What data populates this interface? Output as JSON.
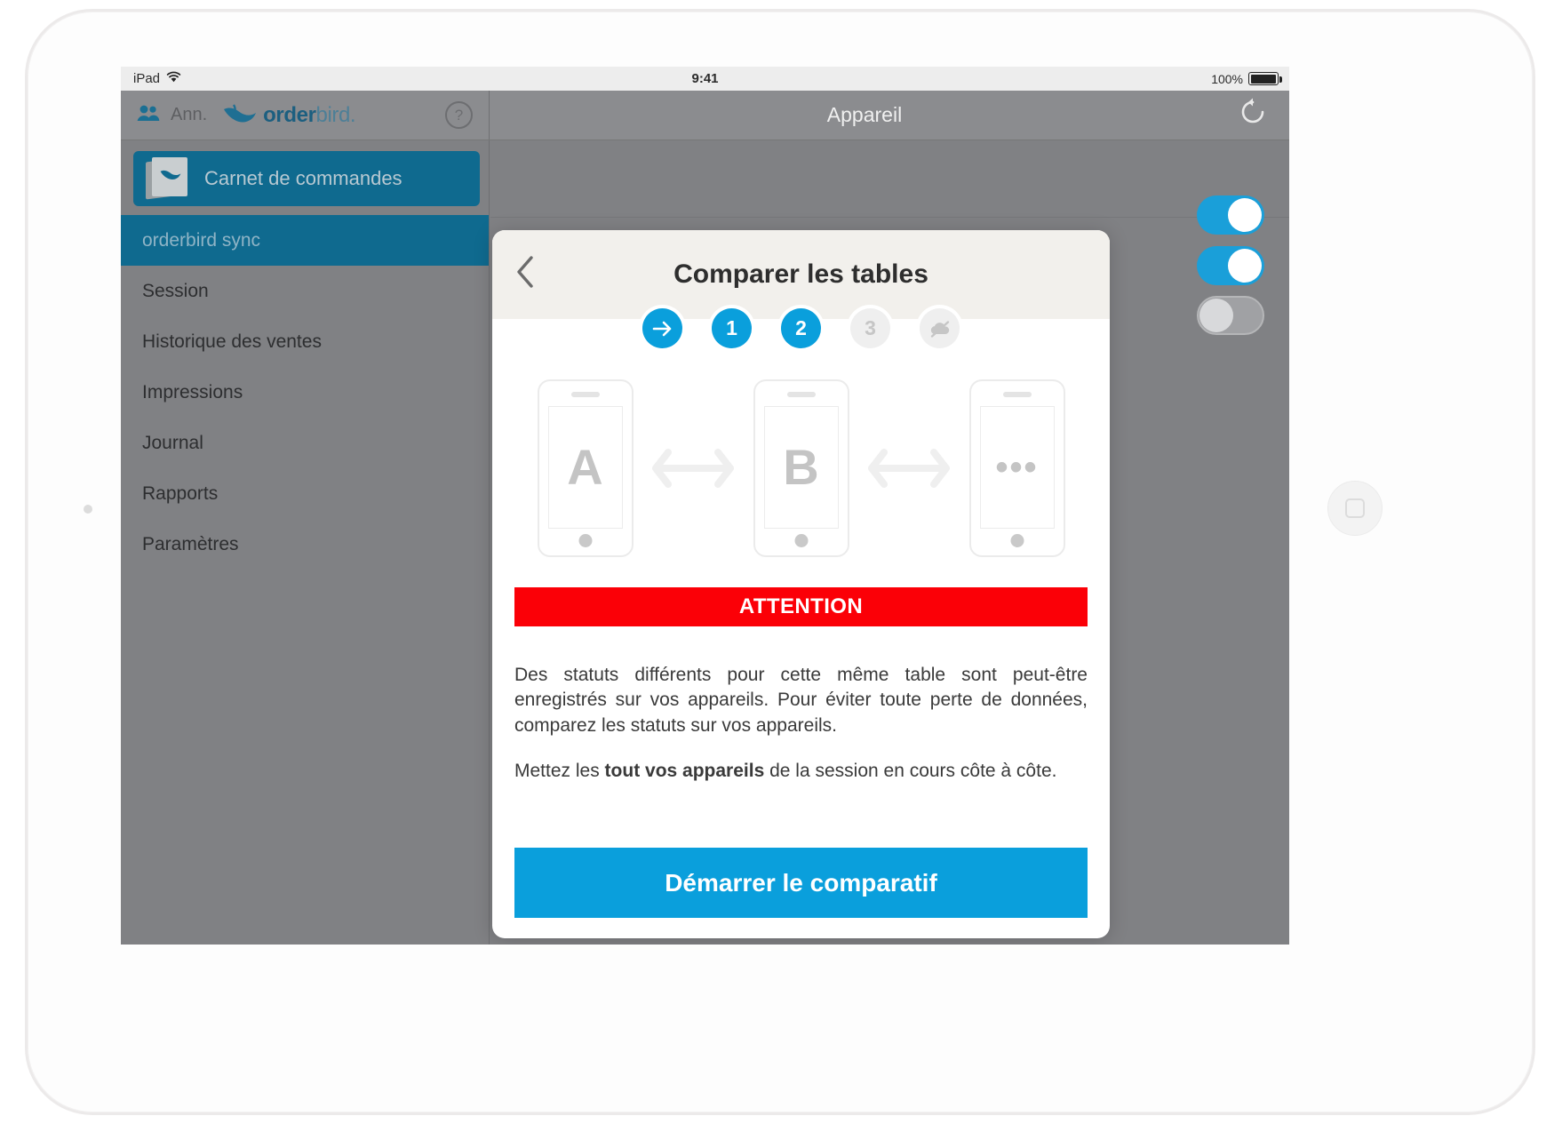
{
  "status_bar": {
    "device": "iPad",
    "wifi_icon": "wifi-icon",
    "time": "9:41",
    "battery_percent": "100%",
    "battery_icon": "battery-full-icon"
  },
  "topbar": {
    "people_icon": "people-icon",
    "user_label": "Ann.",
    "brand_bird_icon": "orderbird-bird-icon",
    "brand_bold": "order",
    "brand_light": "bird.",
    "help_label": "?",
    "page_title": "Appareil",
    "refresh_icon": "refresh-icon"
  },
  "sidebar": {
    "order_book": {
      "icon": "order-book-icon",
      "label": "Carnet de commandes"
    },
    "items": [
      {
        "label": "orderbird sync",
        "active": true
      },
      {
        "label": "Session",
        "active": false
      },
      {
        "label": "Historique des ventes",
        "active": false
      },
      {
        "label": "Impressions",
        "active": false
      },
      {
        "label": "Journal",
        "active": false
      },
      {
        "label": "Rapports",
        "active": false
      },
      {
        "label": "Paramètres",
        "active": false
      }
    ]
  },
  "content": {
    "toggles": [
      {
        "state": "on"
      },
      {
        "state": "on"
      },
      {
        "state": "off"
      }
    ]
  },
  "modal": {
    "back_icon": "chevron-left-icon",
    "title": "Comparer les tables",
    "steps": [
      {
        "label": "→",
        "type": "arrow",
        "active": true
      },
      {
        "label": "1",
        "type": "number",
        "active": true
      },
      {
        "label": "2",
        "type": "number",
        "active": true
      },
      {
        "label": "3",
        "type": "number",
        "active": false
      },
      {
        "label": "☁",
        "type": "cloud-off",
        "active": false
      }
    ],
    "devices": [
      {
        "label": "A"
      },
      {
        "label": "B"
      },
      {
        "label": "•••"
      }
    ],
    "arrow_icon": "double-arrow-icon",
    "attention_label": "ATTENTION",
    "paragraph_1": "Des statuts différents pour cette même table sont peut-être enregistrés sur vos appareils. Pour éviter toute perte de données, comparez les statuts sur vos appareils.",
    "paragraph_2_pre": "Mettez les ",
    "paragraph_2_bold": "tout vos appareils",
    "paragraph_2_post": " de la session en cours côte à côte.",
    "cta_label": "Démarrer le comparatif"
  },
  "colors": {
    "accent_blue": "#0a9fdc",
    "sidebar_active": "#0f6a8f",
    "attention_red": "#fb0007",
    "screen_gray": "#808184"
  }
}
